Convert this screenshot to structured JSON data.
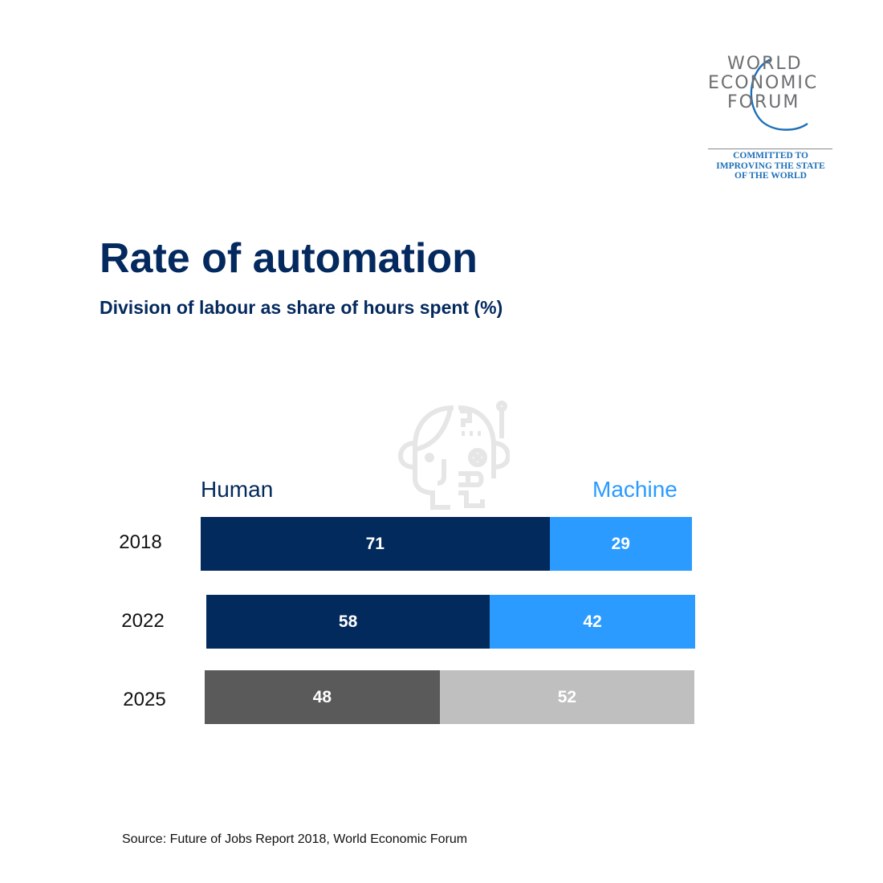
{
  "logo": {
    "lines": [
      "WORLD",
      "ECONOMIC",
      "FORUM"
    ],
    "tagline": [
      "COMMITTED TO",
      "IMPROVING THE STATE",
      "OF THE WORLD"
    ]
  },
  "header": {
    "title": "Rate of automation",
    "subtitle": "Division of labour as share of hours spent (%)"
  },
  "icon": "human-robot-head-icon",
  "colors": {
    "human": "#032a5c",
    "machine": "#2b9bff",
    "human_projected": "#5a5a5a",
    "machine_projected": "#bfbfbf",
    "title": "#04295e",
    "logo_blue": "#1d6fb8"
  },
  "chart_data": {
    "type": "bar",
    "orientation": "horizontal",
    "stacked": true,
    "title": "Rate of automation",
    "subtitle": "Division of labour as share of hours spent (%)",
    "categories": [
      "2018",
      "2022",
      "2025"
    ],
    "series": [
      {
        "name": "Human",
        "values": [
          71,
          58,
          48
        ]
      },
      {
        "name": "Machine",
        "values": [
          29,
          42,
          52
        ]
      }
    ],
    "xlim": [
      0,
      100
    ],
    "legend": "top",
    "grid": false,
    "xlabel": "",
    "ylabel": "",
    "projected_categories": [
      "2025"
    ],
    "source": "Source: Future of Jobs Report 2018, World Economic Forum"
  },
  "footer": {
    "source": "Source: Future of Jobs Report 2018, World Economic Forum"
  }
}
